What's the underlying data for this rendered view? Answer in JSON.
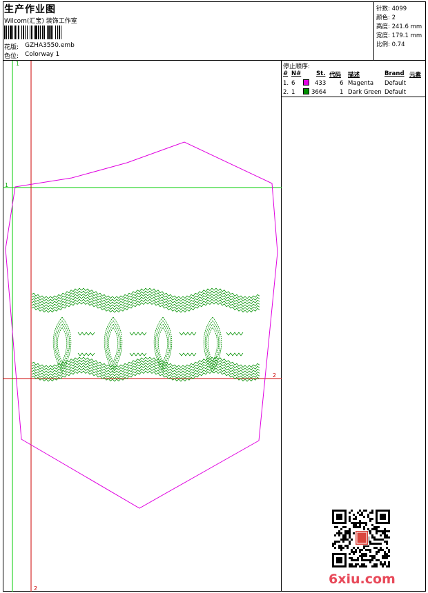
{
  "header": {
    "title": "生产作业图",
    "company": "Wilcom(汇宝) 装饰工作室",
    "design_label": "花版:",
    "design_value": "GZHA3550.emb",
    "colorway_label": "色位:",
    "colorway_value": "Colorway 1"
  },
  "stats": {
    "stitches": "针数: 4099",
    "colors": "颜色: 2",
    "height": "高度: 241.6 mm",
    "width": "宽度: 179.1 mm",
    "scale": "比例: 0.74"
  },
  "stop_sequence": {
    "title": "停止顺序:",
    "headers": {
      "hash": "#",
      "needle": "N#",
      "st": "St.",
      "code": "代码",
      "desc": "描述",
      "brand": "Brand",
      "elements": "元素"
    },
    "rows": [
      {
        "idx": "1.",
        "needle": "6",
        "color": "#e400e4",
        "st": "433",
        "code": "6",
        "desc": "Magenta",
        "brand": "Default"
      },
      {
        "idx": "2.",
        "needle": "1",
        "color": "#009000",
        "st": "3664",
        "code": "1",
        "desc": "Dark Green",
        "brand": "Default"
      }
    ]
  },
  "guides": {
    "green_vertical": "1",
    "green_horizontal": "1",
    "red_vertical": "2",
    "red_horizontal": "2"
  },
  "colors": {
    "outline": "#e000e0",
    "stitch_green": "#009000",
    "guide_green": "#00cc00",
    "guide_red": "#cc0000"
  },
  "watermark": "6xiu.com"
}
